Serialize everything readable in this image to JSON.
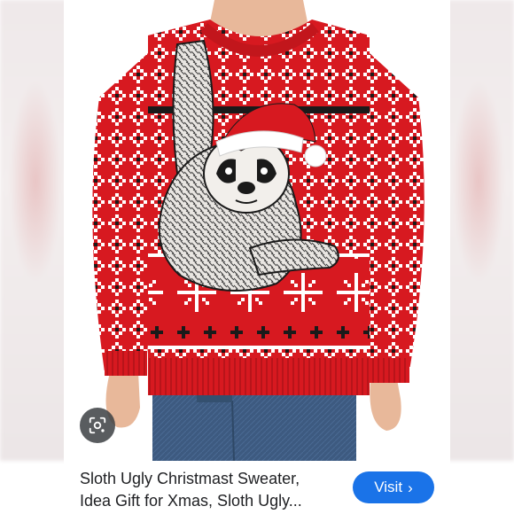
{
  "caption": {
    "title_line1": "Sloth Ugly Christmast Sweater,",
    "title_line2": "Idea Gift for Xmas, Sloth Ugly..."
  },
  "visit_button": {
    "label": "Visit",
    "icon": "chevron-right-icon"
  },
  "lens_button": {
    "icon": "google-lens-icon"
  },
  "colors": {
    "sweater_red": "#d71920",
    "knit_white": "#ffffff",
    "knit_dark": "#1a1a1a",
    "jeans_blue": "#3d5a80",
    "visit_blue": "#1a73e8"
  }
}
